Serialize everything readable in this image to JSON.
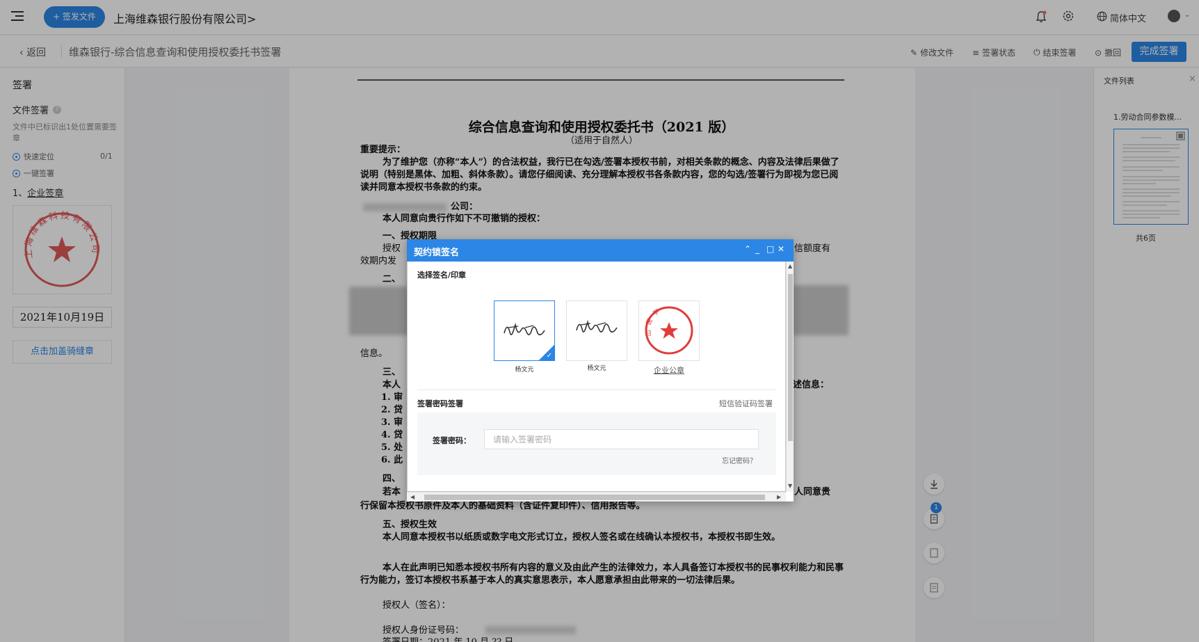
{
  "topbar": {
    "sign_button": "+ 签发文件",
    "company": "上海维森银行股份有限公司>",
    "language": "简体中文",
    "icons": [
      "menu-icon",
      "bell-icon",
      "gear-icon",
      "globe-icon",
      "avatar"
    ]
  },
  "subbar": {
    "back": "返回",
    "doc_title": "维森银行-综合信息查询和使用授权委托书签署",
    "tools": {
      "edit": "修改文件",
      "status": "签署状态",
      "end": "结束签署",
      "revoke": "撤回"
    },
    "finish": "完成签署"
  },
  "left_panel": {
    "title": "签署",
    "file_sign": "文件签署",
    "desc": "文件中已标识出1处位置需要签章",
    "quick_locate": "快速定位",
    "quick_count": "0/1",
    "one_click": "一键签署",
    "enterprise_prefix": "1、",
    "enterprise": "企业签章",
    "date": "2021年10月19日",
    "riding_seal": "点击加盖骑缝章",
    "seal_text": "上海维森科技有限公司"
  },
  "document": {
    "title": "综合信息查询和使用授权委托书（2021 版）",
    "subtitle": "（适用于自然人）",
    "notice_label": "重要提示：",
    "notice_body": "为了维护您（亦称“本人”）的合法权益，我行已在勾选/签署本授权书前，对相关条款的概念、内容及法律后果做了说明（特别是黑体、加粗、斜体条款）。请您仔细阅读、充分理解本授权书各条款内容，您的勾选/签署行为即视为您已阅读并同意本授权书条款的约束。",
    "company_suffix": "公司：",
    "consent": "本人同意向贵行作如下不可撤销的授权：",
    "sec1": "一、授权期限",
    "sec1_a": "授权",
    "sec1_b": "信额度有",
    "sec1_c": "效期内发",
    "sec2": "二、",
    "info": "信息。",
    "sec3": "三、",
    "sec3_a": "本人",
    "sec3_b": "述信息：",
    "list": [
      "1. 审",
      "2. 贷",
      "3. 审",
      "4. 贷",
      "5. 处",
      "6. 此"
    ],
    "sec4": "四、",
    "sec4_a": "若本",
    "sec4_b": "人同意贵",
    "sec4_c": "行保留本授权书原件及本人的基础资料（含证件复印件）、信用报告等。",
    "sec5": "五、授权生效",
    "sec5_body": "本人同意本授权书以纸质或数字电文形式订立，授权人签名或在线确认本授权书，本授权书即生效。",
    "declare": "本人在此声明已知悉本授权书所有内容的意义及由此产生的法律效力，本人具备签订本授权书的民事权利能力和民事行为能力，签订本授权书系基于本人的真实意思表示，本人愿意承担由此带来的一切法律后果。",
    "signer": "授权人（签名）：",
    "idno": "授权人身份证号码：",
    "signdate": "签署日期：2021 年 10 月 ?? 日"
  },
  "right_panel": {
    "title": "文件列表",
    "close": "×",
    "file": "1.劳动合同参数模...",
    "pages": "共6页"
  },
  "float_badge": "1",
  "dialog": {
    "title": "契约锁签名",
    "section_choose": "选择签名/印章",
    "sigs": [
      {
        "caption": "杨文元",
        "selected": true
      },
      {
        "caption": "杨文元",
        "selected": false
      },
      {
        "caption": "企业公章",
        "selected": false
      }
    ],
    "stamp_text": "山医学",
    "section_pwd": "签署密码签署",
    "sms_link": "短信验证码签署",
    "pwd_label": "签署密码：",
    "pwd_placeholder": "请输入签署密码",
    "forgot": "忘记密码？"
  }
}
